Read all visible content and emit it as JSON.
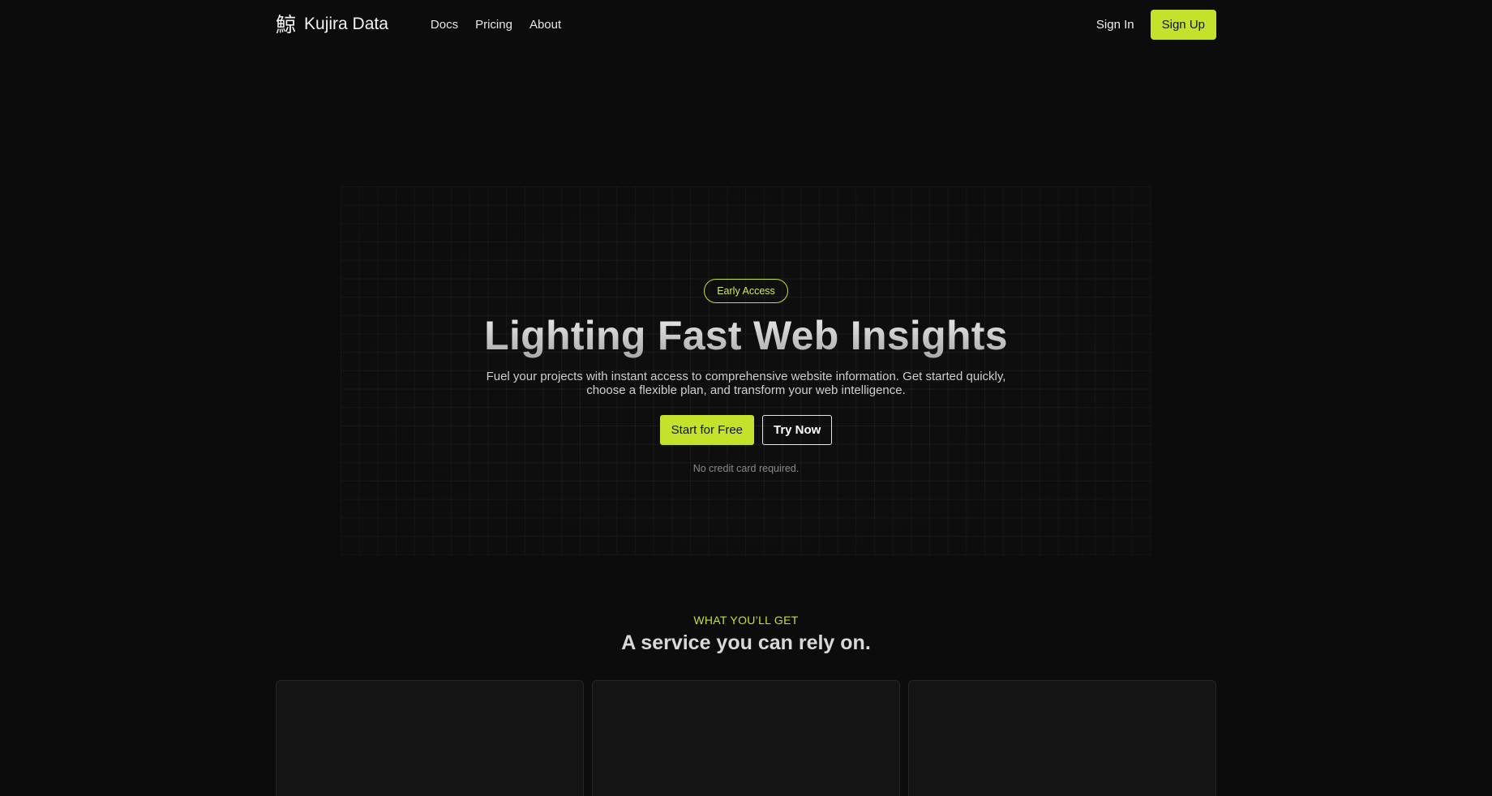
{
  "brand": {
    "glyph": "鯨",
    "name": "Kujira Data"
  },
  "nav": {
    "links": [
      {
        "label": "Docs"
      },
      {
        "label": "Pricing"
      },
      {
        "label": "About"
      }
    ],
    "sign_in": "Sign In",
    "sign_up": "Sign Up"
  },
  "hero": {
    "badge": "Early Access",
    "title": "Lighting Fast Web Insights",
    "subtitle": "Fuel your projects with instant access to comprehensive website information. Get started quickly, choose a flexible plan, and transform your web intelligence.",
    "primary_cta": "Start for Free",
    "secondary_cta": "Try Now",
    "note": "No credit card required."
  },
  "features": {
    "eyebrow": "WHAT YOU’LL GET",
    "title": "A service you can rely on.",
    "cards": [
      {},
      {},
      {}
    ]
  },
  "colors": {
    "accent": "#c4e22b",
    "background": "#0c0c0c"
  }
}
